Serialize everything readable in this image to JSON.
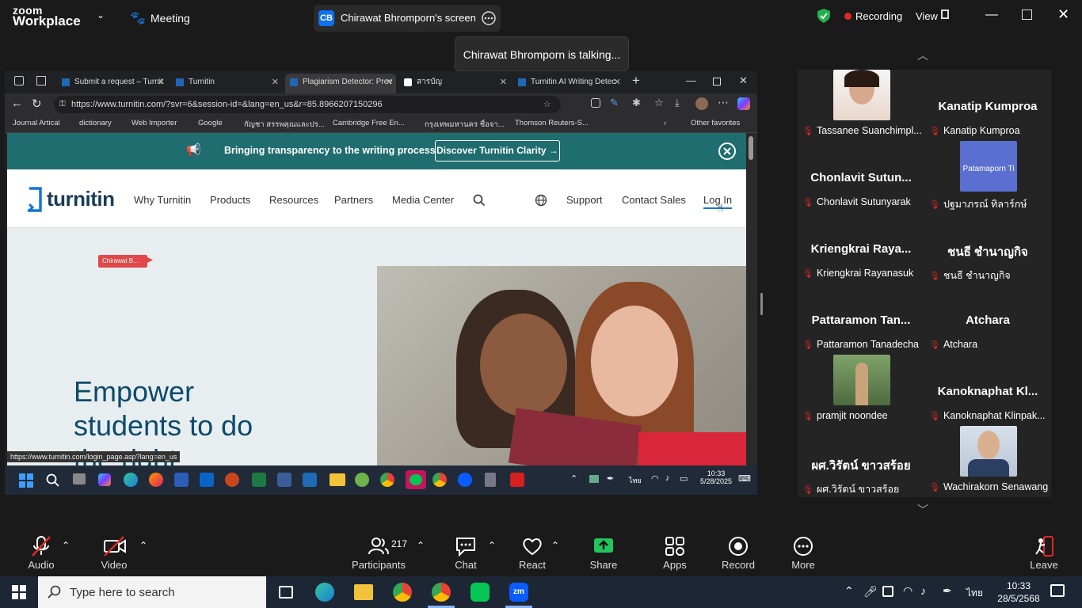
{
  "zoom": {
    "logo_line1": "zoom",
    "logo_line2": "Workplace",
    "meeting_label": "Meeting",
    "share_initials": "CB",
    "share_name": "Chirawat Bhromporn's screen",
    "recording_label": "Recording",
    "view_label": "View",
    "talking": "Chirawat Bhromporn is talking..."
  },
  "browser": {
    "tabs": [
      {
        "label": "Submit a request – Turnit"
      },
      {
        "label": "Turnitin"
      },
      {
        "label": "Plagiarism Detector: Prev"
      },
      {
        "label": "สารบัญ"
      },
      {
        "label": "Turnitin AI Writing Detec"
      }
    ],
    "url": "https://www.turnitin.com/?svr=6&session-id=&lang=en_us&r=85.8966207150296",
    "bookmarks": [
      "Journal Artical",
      "dictionary",
      "Web Importer",
      "Google",
      "กัญชา สรรพคุณและปร...",
      "Cambridge Free En...",
      "กรุงเทพมหานคร ชื่อจา...",
      "Thomson Reuters-S...",
      "Other favorites"
    ],
    "status_url": "https://www.turnitin.com/login_page.asp?lang=en_us"
  },
  "turnitin": {
    "banner_text": "Bringing transparency to the writing process",
    "banner_button": "Discover Turnitin Clarity",
    "logo": "turnitin",
    "nav": [
      "Why Turnitin",
      "Products",
      "Resources",
      "Partners",
      "Media Center",
      "Support",
      "Contact Sales",
      "Log In"
    ],
    "pointer_label": "Chirawat B...",
    "headline_1": "Empower",
    "headline_2": "students to do",
    "headline_3": "the right..."
  },
  "inner_taskbar": {
    "time": "10:33",
    "date": "5/28/2025",
    "lang": "ไทย"
  },
  "participants": [
    {
      "display": "",
      "label": "Tassanee Suanchimpl...",
      "photo": true
    },
    {
      "display": "Kanatip Kumproa",
      "label": "Kanatip Kumproa",
      "photo": false
    },
    {
      "display": "Chonlavit  Sutun...",
      "label": "Chonlavit Sutunyarak",
      "photo": false
    },
    {
      "display": "Patamaporn Ti",
      "label": "ปฐมาภรณ์ ทิลาร์กษ์",
      "photo": true
    },
    {
      "display": "Kriengkrai  Raya...",
      "label": "Kriengkrai Rayanasuk",
      "photo": false
    },
    {
      "display": "ชนธี ชำนาญกิจ",
      "label": "ชนธี ชำนาญกิจ",
      "photo": false
    },
    {
      "display": "Pattaramon  Tan...",
      "label": "Pattaramon Tanadecha",
      "photo": false
    },
    {
      "display": "Atchara",
      "label": "Atchara",
      "photo": false
    },
    {
      "display": "",
      "label": "pramjit noondee",
      "photo": true
    },
    {
      "display": "Kanoknaphat  Kl...",
      "label": "Kanoknaphat Klinpak...",
      "photo": false
    },
    {
      "display": "ผศ.วิรัตน์ ขาวสร้อย",
      "label": "ผศ.วิรัตน์ ขาวสร้อย",
      "photo": false
    },
    {
      "display": "",
      "label": "Wachirakorn Senawang",
      "photo": true
    }
  ],
  "toolbar": {
    "audio": "Audio",
    "video": "Video",
    "participants": "Participants",
    "participants_count": "217",
    "chat": "Chat",
    "react": "React",
    "share": "Share",
    "apps": "Apps",
    "record": "Record",
    "more": "More",
    "leave": "Leave"
  },
  "windows": {
    "search_placeholder": "Type here to search",
    "lang": "ไทย",
    "time": "10:33",
    "date": "28/5/2568"
  }
}
